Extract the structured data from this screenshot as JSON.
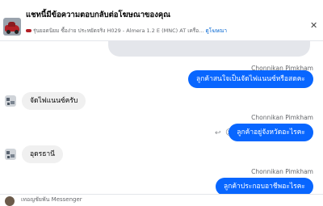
{
  "header": {
    "title": "แชทนี้มีข้อความตอบกลับต่อโฆษณาของคุณ",
    "subtitle": "รุ่นยอดนิยม ซื้อง่าย ประหยัดจริง H029 - Almera 1.2 E (MNC) AT เครื่อ...",
    "link": "ดูโฆษณา",
    "close_icon": "close-icon"
  },
  "messages": [
    {
      "direction": "out",
      "sender": "Chonnikan Pimkham",
      "text": "ลูกค้าสนใจเป็นจัดไฟแนนซ์หรือสดคะ"
    },
    {
      "direction": "in",
      "text": "จัดไฟแนนซ์ครับ"
    },
    {
      "direction": "out",
      "sender": "Chonnikan Pimkham",
      "text": "ลูกค้าอยู่จังหวัดอะไรคะ"
    },
    {
      "direction": "in",
      "text": "อุดรธานี"
    },
    {
      "direction": "out",
      "sender": "Chonnikan Pimkham",
      "text": "ลูกค้าประกอบอาชีพอะไรคะ"
    }
  ],
  "composer": {
    "name": "เทอญชัยพัน Messenger"
  }
}
